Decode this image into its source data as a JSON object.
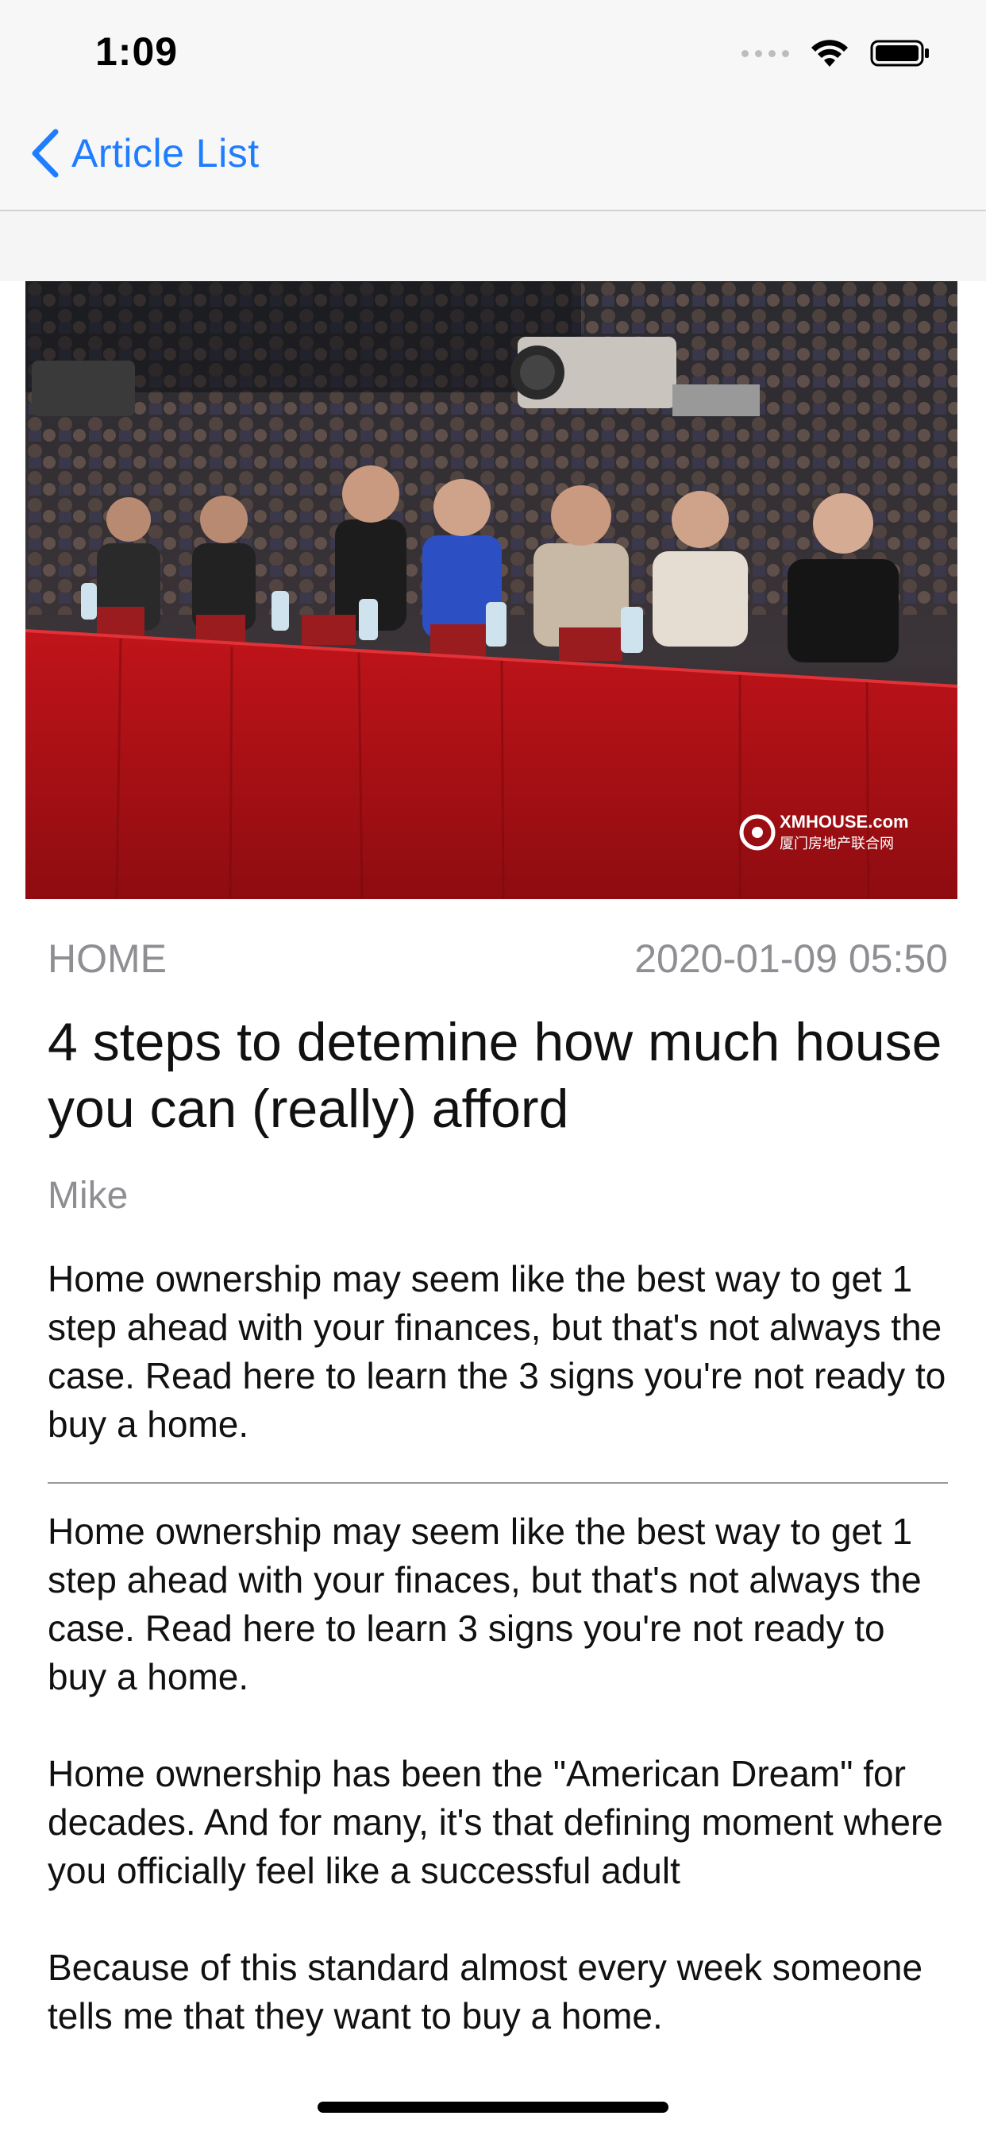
{
  "status_bar": {
    "time": "1:09",
    "icons": [
      "cellular-signal-icon",
      "wifi-icon",
      "battery-icon"
    ]
  },
  "nav": {
    "back_label": "Article List",
    "accent_color": "#1f7dff"
  },
  "article": {
    "category": "HOME",
    "date": "2020-01-09 05:50",
    "title": "4 steps to detemine how much house you can (really) afford",
    "author": "Mike",
    "summary": "Home ownership may seem like the best way to get 1 step ahead with your finances, but that's not always the case. Read here to learn the 3 signs you're not ready to buy a home.",
    "body": [
      "Home ownership may seem like the best way to get 1 step ahead with your finaces, but that's not always the case. Read here to learn 3 signs you're not ready to buy a home.",
      "Home ownership has been the \"American Dream\" for decades. And for many, it's that defining moment where you officially feel like a successful adult",
      "Because of this standard almost every week someone tells me that they want to buy a home."
    ],
    "image": {
      "subject": "panel-seated-at-red-table-photo",
      "watermark_logo": "XMHOUSE.com",
      "watermark_chinese": "厦门房地产联合网"
    }
  }
}
